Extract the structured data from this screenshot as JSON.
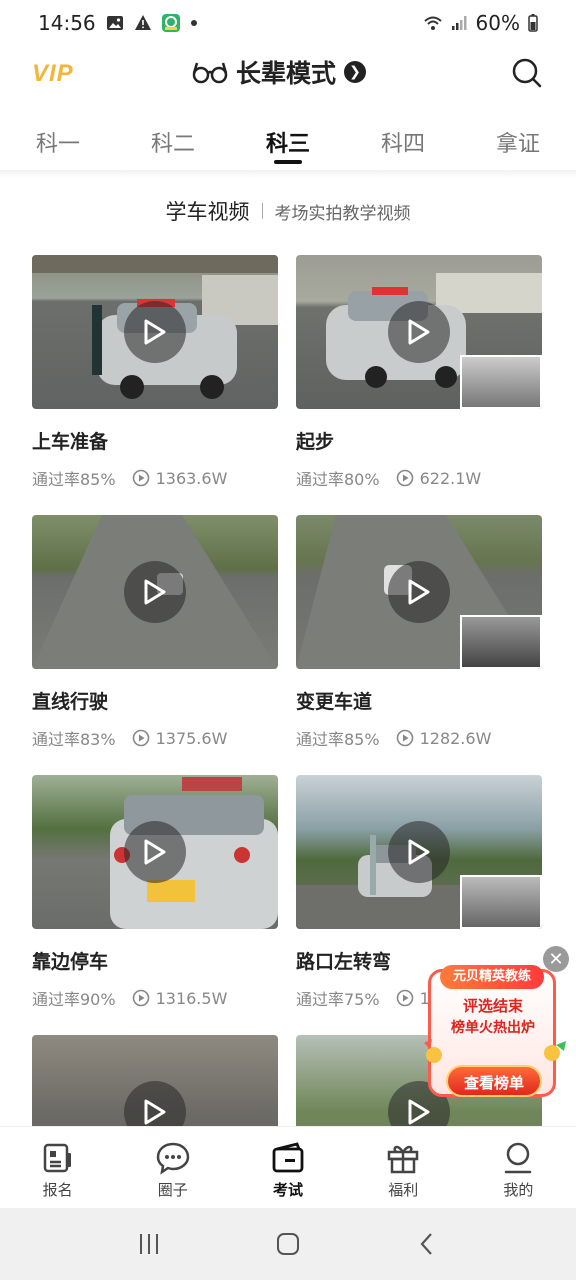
{
  "status": {
    "time": "14:56",
    "battery": "60%"
  },
  "header": {
    "vip": "VIP",
    "mode_title": "长辈模式"
  },
  "tabs": [
    {
      "label": "科一"
    },
    {
      "label": "科二"
    },
    {
      "label": "科三",
      "active": true
    },
    {
      "label": "科四"
    },
    {
      "label": "拿证"
    }
  ],
  "section": {
    "title": "学车视频",
    "subtitle": "考场实拍教学视频"
  },
  "videos": [
    {
      "title": "上车准备",
      "pass_rate": "通过率85%",
      "views": "1363.6W"
    },
    {
      "title": "起步",
      "pass_rate": "通过率80%",
      "views": "622.1W"
    },
    {
      "title": "直线行驶",
      "pass_rate": "通过率83%",
      "views": "1375.6W"
    },
    {
      "title": "变更车道",
      "pass_rate": "通过率85%",
      "views": "1282.6W"
    },
    {
      "title": "靠边停车",
      "pass_rate": "通过率90%",
      "views": "1316.5W"
    },
    {
      "title": "路口左转弯",
      "pass_rate": "通过率75%",
      "views": "1"
    },
    {
      "title": "",
      "pass_rate": "",
      "views": ""
    },
    {
      "title": "",
      "pass_rate": "",
      "views": ""
    }
  ],
  "ad": {
    "tag": "元贝精英教练",
    "line1": "评选结束",
    "line2": "榜单火热出炉",
    "button": "查看榜单"
  },
  "bottom_nav": [
    {
      "label": "报名",
      "icon": "signup-icon"
    },
    {
      "label": "圈子",
      "icon": "chat-icon"
    },
    {
      "label": "考试",
      "icon": "exam-icon",
      "active": true
    },
    {
      "label": "福利",
      "icon": "gift-icon"
    },
    {
      "label": "我的",
      "icon": "profile-icon"
    }
  ],
  "colors": {
    "vip_gold": "#f4b63a",
    "ad_red": "#e0231c"
  }
}
